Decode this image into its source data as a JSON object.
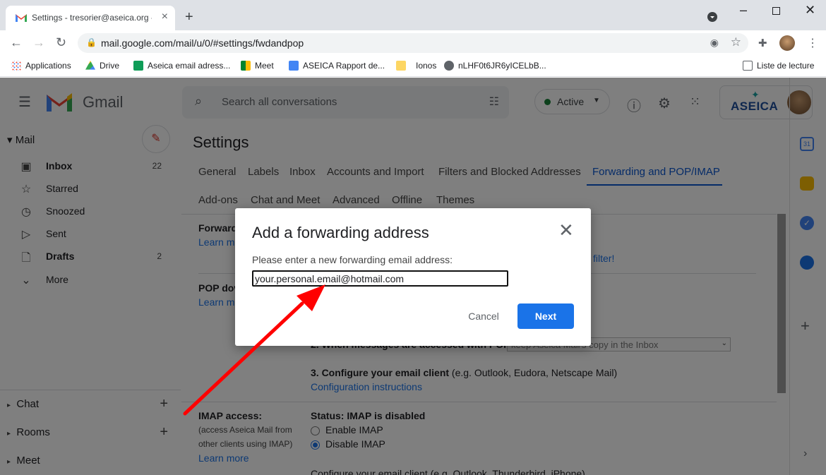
{
  "browser": {
    "tab_title": "Settings - tresorier@aseica.org -",
    "url": "mail.google.com/mail/u/0/#settings/fwdandpop",
    "bookmarks": [
      "Applications",
      "Drive",
      "Aseica email adress...",
      "Meet",
      "ASEICA Rapport de...",
      "Ionos",
      "nLHF0t6JR6yICELbB..."
    ],
    "reading_list": "Liste de lecture"
  },
  "gmail": {
    "logo_text": "Gmail",
    "search_placeholder": "Search all conversations",
    "status": "Active",
    "account_logo": "ASEICA",
    "nav": {
      "mail_heading": "Mail",
      "items": [
        {
          "label": "Inbox",
          "count": "22"
        },
        {
          "label": "Starred",
          "count": ""
        },
        {
          "label": "Snoozed",
          "count": ""
        },
        {
          "label": "Sent",
          "count": ""
        },
        {
          "label": "Drafts",
          "count": "2"
        },
        {
          "label": "More",
          "count": ""
        }
      ],
      "sections": [
        "Chat",
        "Rooms",
        "Meet"
      ]
    },
    "settings": {
      "title": "Settings",
      "tabs_row1": [
        "General",
        "Labels",
        "Inbox",
        "Accounts and Import",
        "Filters and Blocked Addresses",
        "Forwarding and POP/IMAP"
      ],
      "tabs_row2": [
        "Add-ons",
        "Chat and Meet",
        "Advanced",
        "Offline",
        "Themes"
      ],
      "forwarding_label": "Forward",
      "learn_more_partial": "Learn m",
      "filter_link": "filter!",
      "pop_label": "POP dov",
      "pop_step2": "2. When messages are accessed with POP",
      "pop_select_value": "keep Aseica Mail's copy in the Inbox",
      "pop_step3_bold": "3. Configure your email client",
      "pop_step3_rest": " (e.g. Outlook, Eudora, Netscape Mail)",
      "config_link": "Configuration instructions",
      "imap_label": "IMAP access:",
      "imap_desc": "(access Aseica Mail from other clients using IMAP)",
      "imap_learn_more": "Learn more",
      "imap_status": "Status: IMAP is disabled",
      "imap_enable": "Enable IMAP",
      "imap_disable": "Disable IMAP",
      "imap_configure": "Configure your email client (e.g. Outlook, Thunderbird, iPhone)"
    }
  },
  "dialog": {
    "title": "Add a forwarding address",
    "prompt": "Please enter a new forwarding email address:",
    "input_value": "your.personal.email@hotmail.com",
    "cancel_label": "Cancel",
    "next_label": "Next"
  },
  "colors": {
    "accent": "#1a73e8",
    "arrow": "#ff0000"
  }
}
